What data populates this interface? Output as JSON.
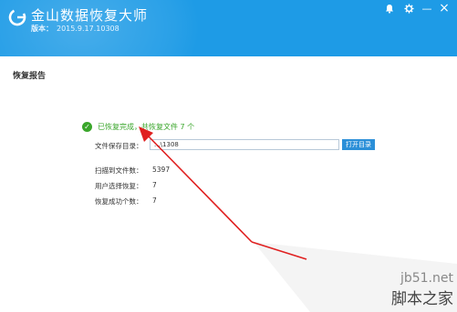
{
  "app": {
    "title": "金山数据恢复大师",
    "version_label": "版本：",
    "version": "2015.9.17.10308"
  },
  "window_controls": {
    "icons": [
      "bell-icon",
      "gear-icon",
      "minimize-icon",
      "close-icon"
    ],
    "minimize": "—",
    "close": "×"
  },
  "report": {
    "title": "恢复报告",
    "status": "已恢复完成，共恢复文件 7 个",
    "save_dir_label": "文件保存目录：",
    "save_dir_value": "...\\1308",
    "open_dir_button": "打开目录",
    "stats": [
      {
        "label": "扫描到文件数：",
        "value": "5397"
      },
      {
        "label": "用户选择恢复：",
        "value": "7"
      },
      {
        "label": "恢复成功个数：",
        "value": "7"
      }
    ]
  },
  "watermark": {
    "site": "jb51.net",
    "name": "脚本之家"
  },
  "colors": {
    "titlebar": "#1e9be6",
    "success": "#3aa62b",
    "button": "#2b8fd8",
    "arrow": "#e02020"
  }
}
